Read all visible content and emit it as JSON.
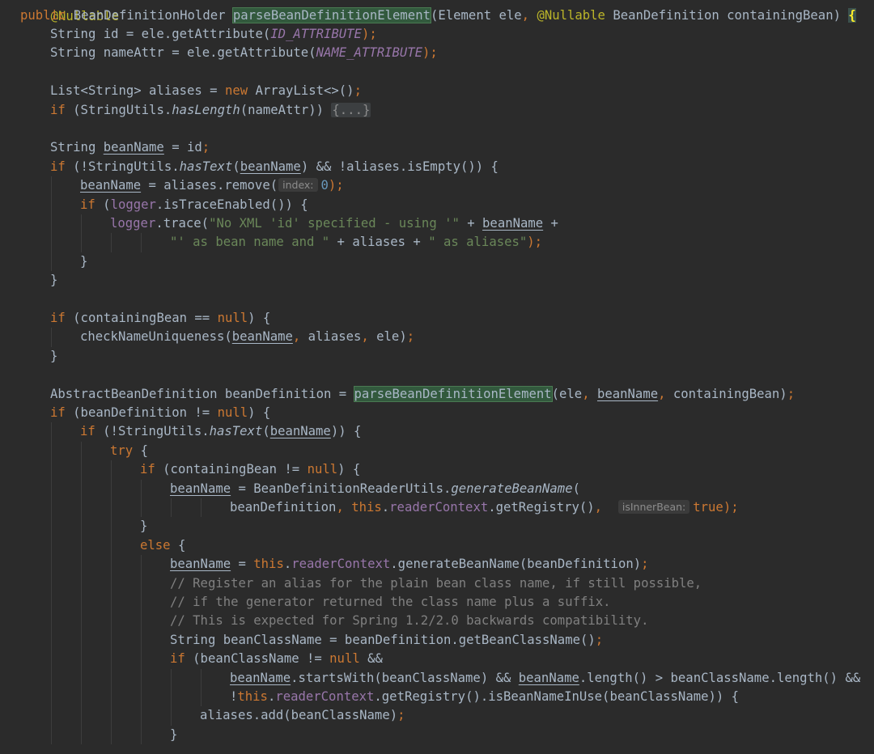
{
  "editor": {
    "top_partial": "@Nullable",
    "lines": [
      {
        "indent": 0,
        "tokens": [
          {
            "t": "public ",
            "c": "kw"
          },
          {
            "t": "BeanDefinitionHolder "
          },
          {
            "t": "parseBeanDefinitionElement",
            "c": "hl"
          },
          {
            "t": "(Element ele"
          },
          {
            "t": ", ",
            "c": "kw"
          },
          {
            "t": "@Nullable ",
            "c": "ann"
          },
          {
            "t": "BeanDefinition containingBean) "
          },
          {
            "t": "{",
            "c": "brace-hl"
          }
        ]
      },
      {
        "indent": 1,
        "tokens": [
          {
            "t": "String id = ele.getAttribute("
          },
          {
            "t": "ID_ATTRIBUTE",
            "c": "const"
          },
          {
            "t": ");",
            "c": "kw"
          }
        ]
      },
      {
        "indent": 1,
        "tokens": [
          {
            "t": "String nameAttr = ele.getAttribute("
          },
          {
            "t": "NAME_ATTRIBUTE",
            "c": "const"
          },
          {
            "t": ");",
            "c": "kw"
          }
        ]
      },
      {
        "indent": 0,
        "tokens": []
      },
      {
        "indent": 1,
        "tokens": [
          {
            "t": "List<String> aliases = "
          },
          {
            "t": "new ",
            "c": "kw"
          },
          {
            "t": "ArrayList<>()"
          },
          {
            "t": ";",
            "c": "kw"
          }
        ]
      },
      {
        "indent": 1,
        "tokens": [
          {
            "t": "if ",
            "c": "kw"
          },
          {
            "t": "(StringUtils."
          },
          {
            "t": "hasLength",
            "c": "ital"
          },
          {
            "t": "(nameAttr)) "
          },
          {
            "t": "{...}",
            "c": "fold"
          }
        ]
      },
      {
        "indent": 0,
        "tokens": []
      },
      {
        "indent": 1,
        "tokens": [
          {
            "t": "String "
          },
          {
            "t": "beanName",
            "c": "ul"
          },
          {
            "t": " = id"
          },
          {
            "t": ";",
            "c": "kw"
          }
        ]
      },
      {
        "indent": 1,
        "tokens": [
          {
            "t": "if ",
            "c": "kw"
          },
          {
            "t": "(!StringUtils."
          },
          {
            "t": "hasText",
            "c": "ital"
          },
          {
            "t": "("
          },
          {
            "t": "beanName",
            "c": "ul"
          },
          {
            "t": ") && !aliases.isEmpty()) {"
          }
        ]
      },
      {
        "indent": 2,
        "tokens": [
          {
            "t": "beanName",
            "c": "ul"
          },
          {
            "t": " = aliases.remove("
          },
          {
            "t": "index:",
            "c": "hint"
          },
          {
            "t": "0",
            "c": "num"
          },
          {
            "t": ");",
            "c": "kw"
          }
        ]
      },
      {
        "indent": 2,
        "tokens": [
          {
            "t": "if ",
            "c": "kw"
          },
          {
            "t": "("
          },
          {
            "t": "logger",
            "c": "field"
          },
          {
            "t": ".isTraceEnabled()) {"
          }
        ]
      },
      {
        "indent": 3,
        "tokens": [
          {
            "t": "logger",
            "c": "field"
          },
          {
            "t": ".trace("
          },
          {
            "t": "\"No XML 'id' specified - using '\"",
            "c": "str"
          },
          {
            "t": " + "
          },
          {
            "t": "beanName",
            "c": "ul"
          },
          {
            "t": " +"
          }
        ]
      },
      {
        "indent": 5,
        "tokens": [
          {
            "t": "\"' as bean name and \"",
            "c": "str"
          },
          {
            "t": " + aliases + "
          },
          {
            "t": "\" as aliases\"",
            "c": "str"
          },
          {
            "t": ");",
            "c": "kw"
          }
        ]
      },
      {
        "indent": 2,
        "tokens": [
          {
            "t": "}"
          }
        ]
      },
      {
        "indent": 1,
        "tokens": [
          {
            "t": "}"
          }
        ]
      },
      {
        "indent": 0,
        "tokens": []
      },
      {
        "indent": 1,
        "tokens": [
          {
            "t": "if ",
            "c": "kw"
          },
          {
            "t": "(containingBean == "
          },
          {
            "t": "null",
            "c": "kw"
          },
          {
            "t": ") {"
          }
        ]
      },
      {
        "indent": 2,
        "tokens": [
          {
            "t": "checkNameUniqueness("
          },
          {
            "t": "beanName",
            "c": "ul"
          },
          {
            "t": ", ",
            "c": "kw"
          },
          {
            "t": "aliases"
          },
          {
            "t": ", ",
            "c": "kw"
          },
          {
            "t": "ele)"
          },
          {
            "t": ";",
            "c": "kw"
          }
        ]
      },
      {
        "indent": 1,
        "tokens": [
          {
            "t": "}"
          }
        ]
      },
      {
        "indent": 0,
        "tokens": []
      },
      {
        "indent": 1,
        "tokens": [
          {
            "t": "AbstractBeanDefinition beanDefinition = "
          },
          {
            "t": "parseBeanDefinitionElement",
            "c": "hl"
          },
          {
            "t": "(ele"
          },
          {
            "t": ", ",
            "c": "kw"
          },
          {
            "t": "beanName",
            "c": "ul"
          },
          {
            "t": ", ",
            "c": "kw"
          },
          {
            "t": "containingBean)"
          },
          {
            "t": ";",
            "c": "kw"
          }
        ]
      },
      {
        "indent": 1,
        "tokens": [
          {
            "t": "if ",
            "c": "kw"
          },
          {
            "t": "(beanDefinition != "
          },
          {
            "t": "null",
            "c": "kw"
          },
          {
            "t": ") {"
          }
        ]
      },
      {
        "indent": 2,
        "tokens": [
          {
            "t": "if ",
            "c": "kw"
          },
          {
            "t": "(!StringUtils."
          },
          {
            "t": "hasText",
            "c": "ital"
          },
          {
            "t": "("
          },
          {
            "t": "beanName",
            "c": "ul"
          },
          {
            "t": ")) {"
          }
        ]
      },
      {
        "indent": 3,
        "tokens": [
          {
            "t": "try ",
            "c": "kw"
          },
          {
            "t": "{"
          }
        ]
      },
      {
        "indent": 4,
        "tokens": [
          {
            "t": "if ",
            "c": "kw"
          },
          {
            "t": "(containingBean != "
          },
          {
            "t": "null",
            "c": "kw"
          },
          {
            "t": ") {"
          }
        ]
      },
      {
        "indent": 5,
        "tokens": [
          {
            "t": "beanName",
            "c": "ul"
          },
          {
            "t": " = BeanDefinitionReaderUtils."
          },
          {
            "t": "generateBeanName",
            "c": "ital"
          },
          {
            "t": "("
          }
        ]
      },
      {
        "indent": 7,
        "tokens": [
          {
            "t": "beanDefinition"
          },
          {
            "t": ", ",
            "c": "kw"
          },
          {
            "t": "this",
            "c": "kw"
          },
          {
            "t": "."
          },
          {
            "t": "readerContext",
            "c": "field"
          },
          {
            "t": ".getRegistry()"
          },
          {
            "t": ", ",
            "c": "kw"
          },
          {
            "t": " "
          },
          {
            "t": "isInnerBean:",
            "c": "hint"
          },
          {
            "t": "true",
            "c": "kw"
          },
          {
            "t": ");",
            "c": "kw"
          }
        ]
      },
      {
        "indent": 4,
        "tokens": [
          {
            "t": "}"
          }
        ]
      },
      {
        "indent": 4,
        "tokens": [
          {
            "t": "else ",
            "c": "kw"
          },
          {
            "t": "{"
          }
        ]
      },
      {
        "indent": 5,
        "tokens": [
          {
            "t": "beanName",
            "c": "ul"
          },
          {
            "t": " = "
          },
          {
            "t": "this",
            "c": "kw"
          },
          {
            "t": "."
          },
          {
            "t": "readerContext",
            "c": "field"
          },
          {
            "t": ".generateBeanName(beanDefinition)"
          },
          {
            "t": ";",
            "c": "kw"
          }
        ]
      },
      {
        "indent": 5,
        "tokens": [
          {
            "t": "// Register an alias for the plain bean class name, if still possible,",
            "c": "cmt"
          }
        ]
      },
      {
        "indent": 5,
        "tokens": [
          {
            "t": "// if the generator returned the class name plus a suffix.",
            "c": "cmt"
          }
        ]
      },
      {
        "indent": 5,
        "tokens": [
          {
            "t": "// This is expected for Spring 1.2/2.0 backwards compatibility.",
            "c": "cmt"
          }
        ]
      },
      {
        "indent": 5,
        "tokens": [
          {
            "t": "String beanClassName = beanDefinition.getBeanClassName()"
          },
          {
            "t": ";",
            "c": "kw"
          }
        ]
      },
      {
        "indent": 5,
        "tokens": [
          {
            "t": "if ",
            "c": "kw"
          },
          {
            "t": "(beanClassName != "
          },
          {
            "t": "null ",
            "c": "kw"
          },
          {
            "t": "&&"
          }
        ]
      },
      {
        "indent": 7,
        "tokens": [
          {
            "t": "beanName",
            "c": "ul"
          },
          {
            "t": ".startsWith(beanClassName) && "
          },
          {
            "t": "beanName",
            "c": "ul"
          },
          {
            "t": ".length() > beanClassName.length() &&"
          }
        ]
      },
      {
        "indent": 7,
        "tokens": [
          {
            "t": "!"
          },
          {
            "t": "this",
            "c": "kw"
          },
          {
            "t": "."
          },
          {
            "t": "readerContext",
            "c": "field"
          },
          {
            "t": ".getRegistry().isBeanNameInUse(beanClassName)) {"
          }
        ]
      },
      {
        "indent": 6,
        "tokens": [
          {
            "t": "aliases.add(beanClassName)"
          },
          {
            "t": ";",
            "c": "kw"
          }
        ]
      },
      {
        "indent": 5,
        "tokens": [
          {
            "t": "}"
          }
        ]
      }
    ]
  }
}
